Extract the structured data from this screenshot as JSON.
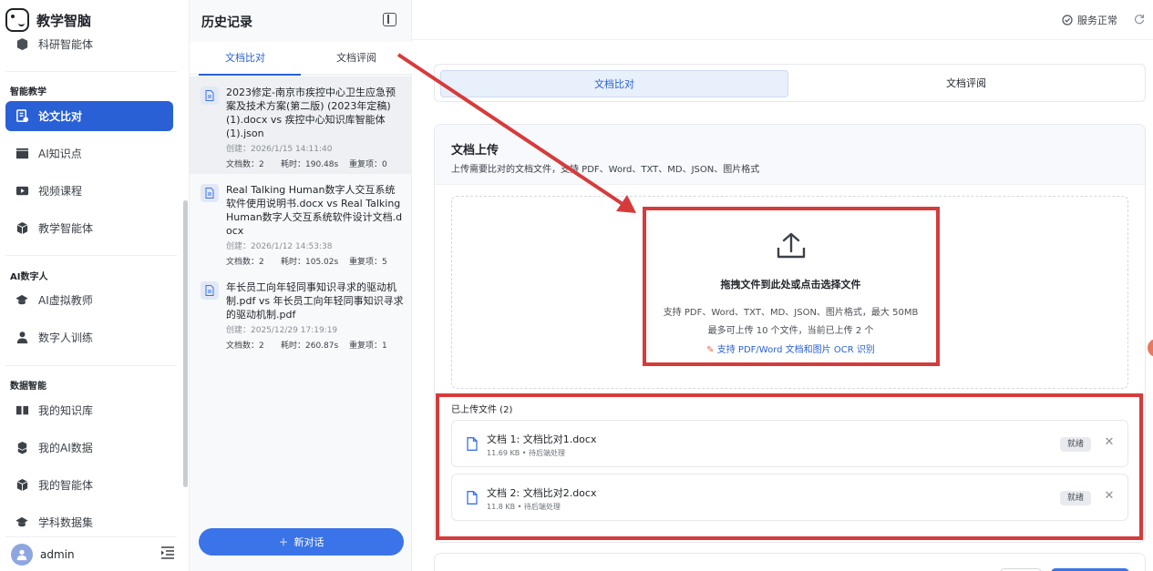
{
  "brand": {
    "name": "教学智脑"
  },
  "sidebar": {
    "top_item": "科研智能体",
    "sections": [
      {
        "title": "智能教学",
        "items": [
          "论文比对",
          "AI知识点",
          "视频课程",
          "教学智能体"
        ]
      },
      {
        "title": "AI数字人",
        "items": [
          "AI虚拟教师",
          "数字人训练"
        ]
      },
      {
        "title": "数据智能",
        "items": [
          "我的知识库",
          "我的AI数据",
          "我的智能体",
          "学科数据集"
        ]
      }
    ],
    "active_item": "论文比对",
    "user": "admin"
  },
  "history": {
    "title": "历史记录",
    "tabs": [
      "文档比对",
      "文档评阅"
    ],
    "active_tab": "文档比对",
    "items": [
      {
        "name": "2023修定-南京市疾控中心卫生应急预案及技术方案(第二版) (2023年定稿) (1).docx vs 疾控中心知识库智能体 (1).json",
        "created": "创建：2026/1/15 14:11:40",
        "docs": "文档数：2",
        "time": "耗时：190.48s",
        "dup": "重复项：0"
      },
      {
        "name": "Real Talking Human数字人交互系统软件使用说明书.docx vs Real Talking Human数字人交互系统软件设计文档.docx",
        "created": "创建：2026/1/12 14:53:38",
        "docs": "文档数：2",
        "time": "耗时：105.02s",
        "dup": "重复项：5"
      },
      {
        "name": "年长员工向年轻同事知识寻求的驱动机制.pdf vs 年长员工向年轻同事知识寻求的驱动机制.pdf",
        "created": "创建：2025/12/29 17:19:19",
        "docs": "文档数：2",
        "time": "耗时：260.87s",
        "dup": "重复项：1"
      }
    ],
    "new_chat": "新对话"
  },
  "main": {
    "status": "服务正常",
    "tabs": [
      "文档比对",
      "文档评阅"
    ],
    "active_tab": "文档比对",
    "upload": {
      "title": "文档上传",
      "subtitle": "上传需要比对的文档文件，支持 PDF、Word、TXT、MD、JSON、图片格式",
      "drop_main": "拖拽文件到此处或点击选择文件",
      "drop_line1": "支持 PDF、Word、TXT、MD、JSON、图片格式，最大 50MB",
      "drop_line2": "最多可上传 10 个文件，当前已上传 2 个",
      "drop_ocr": "支持 PDF/Word 文档和图片 OCR 识别"
    },
    "files_title": "已上传文件 (2)",
    "files": [
      {
        "name": "文档 1: 文档比对1.docx",
        "meta": "11.69 KB • 待后端处理",
        "status": "就绪"
      },
      {
        "name": "文档 2: 文档比对2.docx",
        "meta": "11.8 KB • 待后端处理",
        "status": "就绪"
      }
    ]
  },
  "colors": {
    "accent": "#2a60d6",
    "annotation": "#d63b3b"
  }
}
